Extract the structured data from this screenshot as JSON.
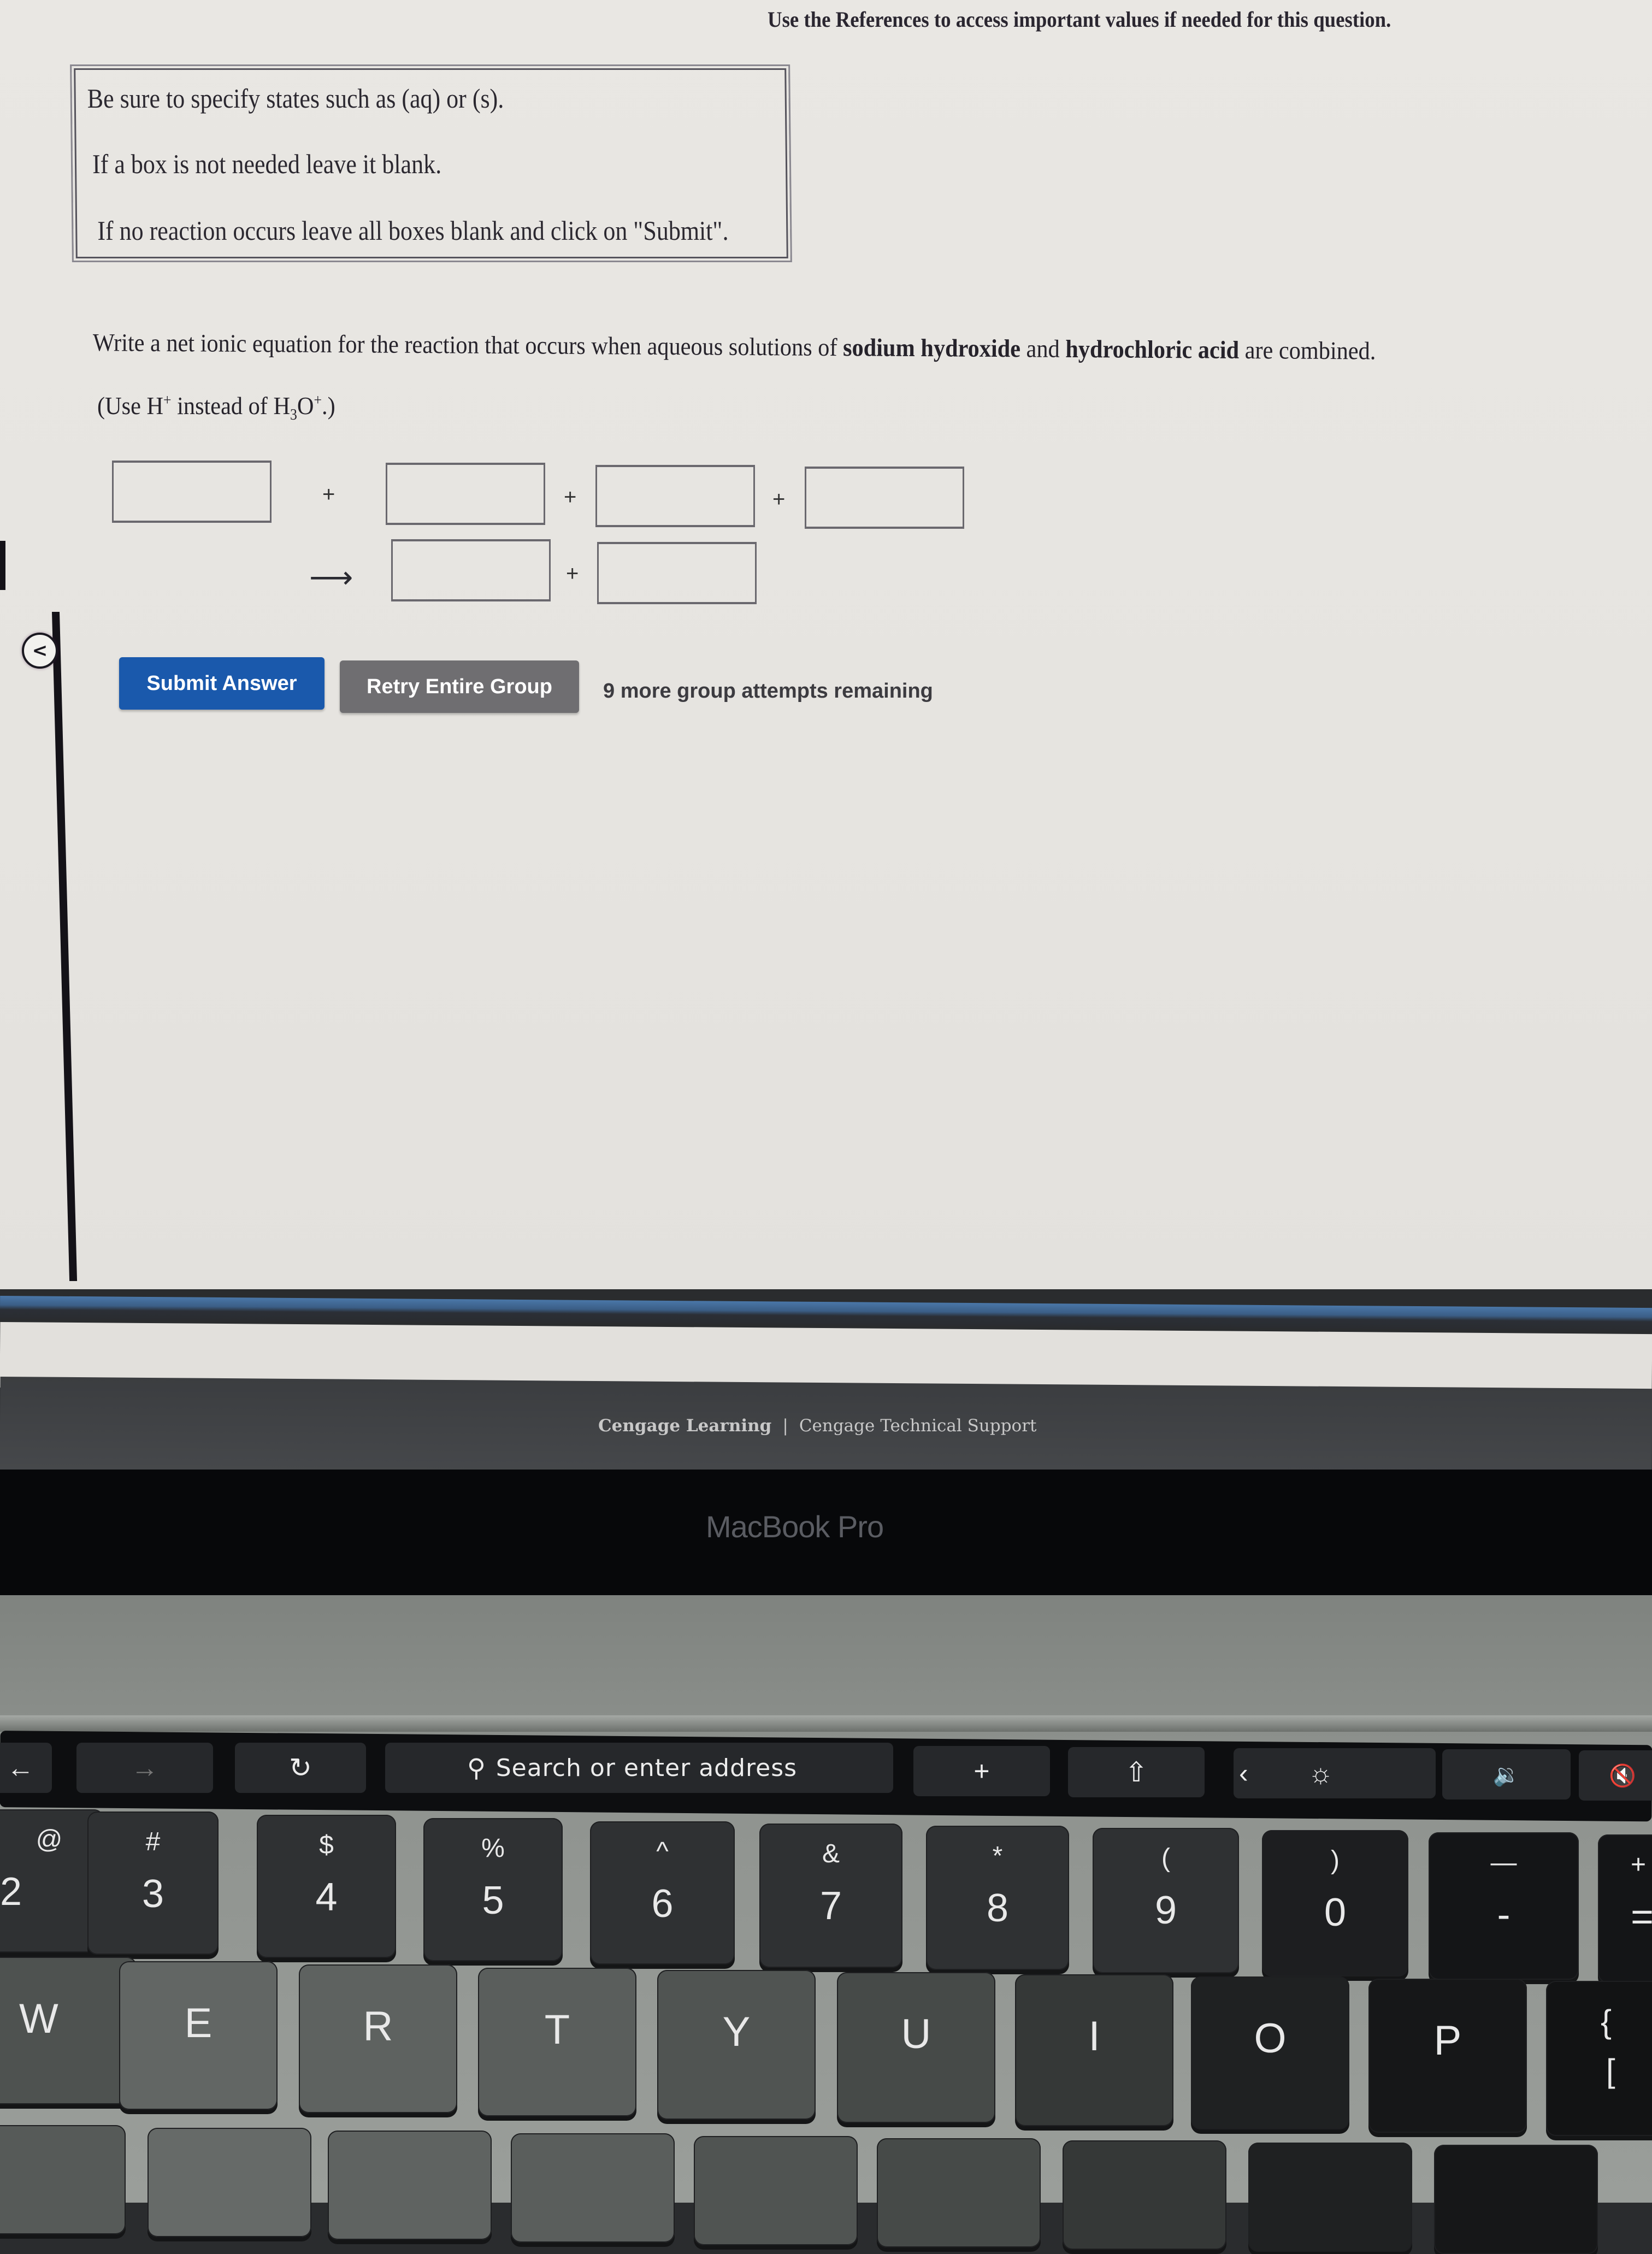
{
  "page": {
    "reference_note": "Use the References to access important values if needed for this question.",
    "instructions": [
      "Be sure to specify states such as (aq) or (s).",
      "If a box is not needed leave it blank.",
      "If no reaction occurs leave all boxes blank and click on \"Submit\"."
    ],
    "question": {
      "prefix": "Write a net ionic equation for the reaction that occurs when aqueous solutions of ",
      "reactant1": "sodium hydroxide",
      "middle": " and ",
      "reactant2": "hydrochloric acid",
      "suffix": " are combined."
    },
    "hint": {
      "open": "(Use H",
      "sup1": "+",
      "mid": " instead of H",
      "sub": "3",
      "o": "O",
      "sup2": "+",
      "close": ".)"
    },
    "equation": {
      "reactant_boxes": [
        "",
        "",
        "",
        ""
      ],
      "product_boxes": [
        "",
        ""
      ],
      "plus": "+",
      "arrow": "⟶"
    },
    "buttons": {
      "submit": "Submit Answer",
      "retry": "Retry Entire Group"
    },
    "attempts_text": "9 more group attempts remaining",
    "collapse_icon": "<",
    "colors": {
      "submit": "#1a59ac",
      "retry": "#6f6e71",
      "divider": "#4a77a8"
    },
    "footer": {
      "link1": "Cengage Learning",
      "separator": "|",
      "link2": "Cengage Technical Support"
    }
  },
  "device": {
    "bezel_label": "MacBook Pro",
    "touchbar": {
      "back": "←",
      "forward": "→",
      "reload": "↻",
      "search_icon": "⚲",
      "search_placeholder": "Search or enter address",
      "new_tab": "+",
      "share": "⇧",
      "collapse": "‹",
      "brightness": "☼",
      "volume": "🔉",
      "mute": "🔇"
    },
    "number_row": [
      {
        "top": "@",
        "bottom": "2"
      },
      {
        "top": "#",
        "bottom": "3"
      },
      {
        "top": "$",
        "bottom": "4"
      },
      {
        "top": "%",
        "bottom": "5"
      },
      {
        "top": "^",
        "bottom": "6"
      },
      {
        "top": "&",
        "bottom": "7"
      },
      {
        "top": "*",
        "bottom": "8"
      },
      {
        "top": "(",
        "bottom": "9"
      },
      {
        "top": ")",
        "bottom": "0"
      },
      {
        "top": "—",
        "bottom": "-"
      },
      {
        "top": "+",
        "bottom": "="
      }
    ],
    "letter_row": [
      "W",
      "E",
      "R",
      "T",
      "Y",
      "U",
      "I",
      "O",
      "P"
    ],
    "bracket_key": {
      "top": "{",
      "bottom": "["
    }
  }
}
